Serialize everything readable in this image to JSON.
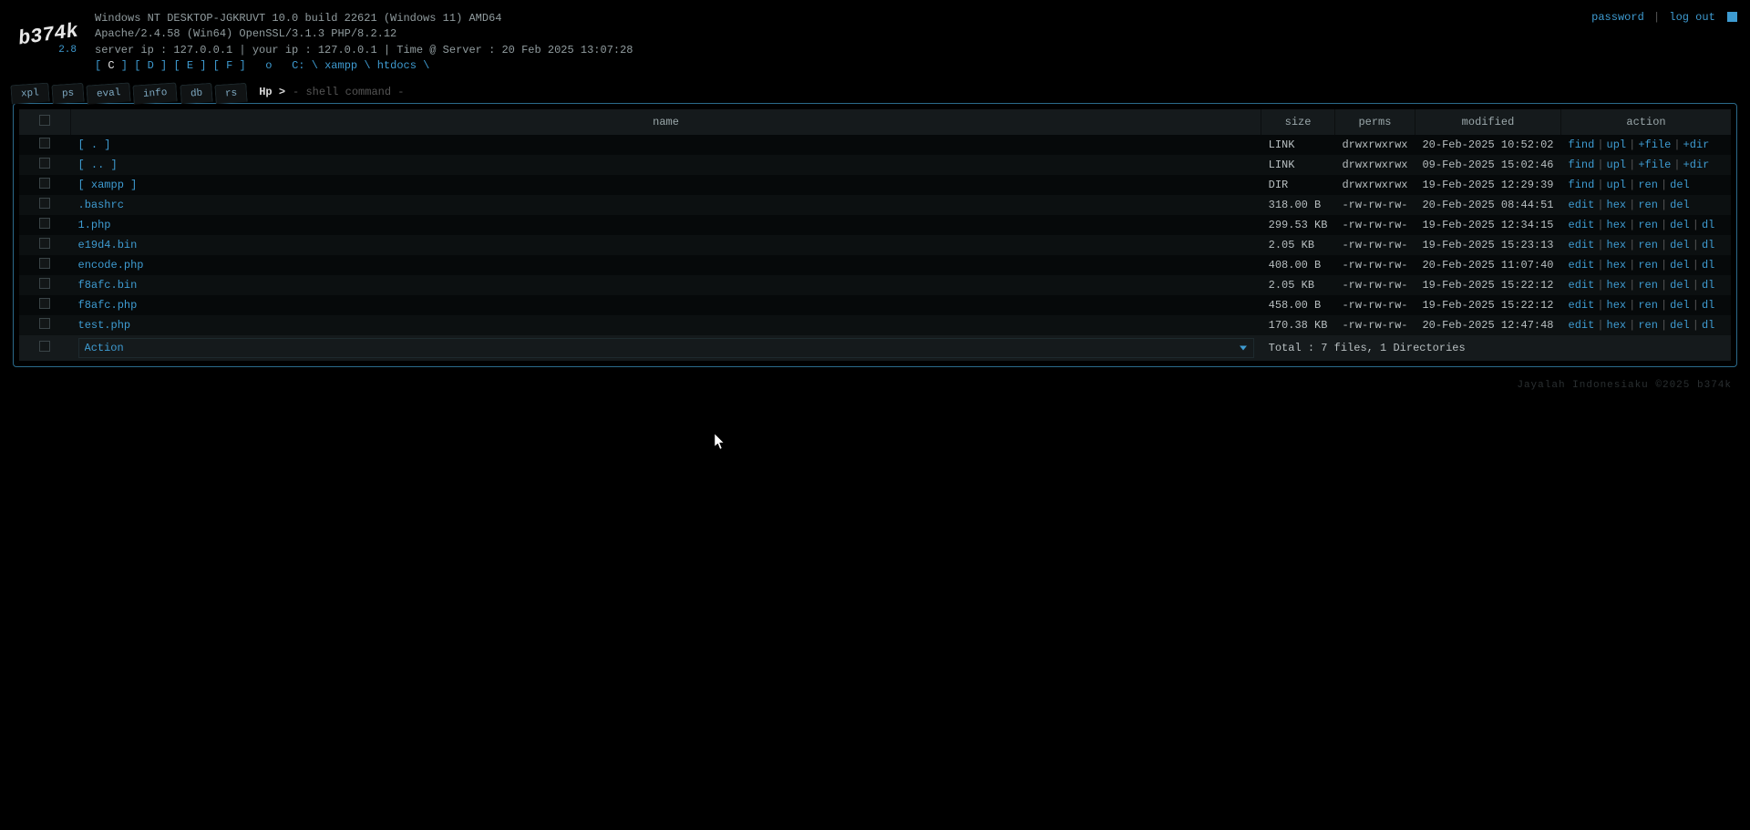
{
  "logo": {
    "main": "b374k",
    "sub": "2.8"
  },
  "topright": {
    "password": "password",
    "logout": "log out"
  },
  "sys": {
    "os": "Windows NT DESKTOP-JGKRUVT 10.0 build 22621 (Windows 11) AMD64",
    "server": "Apache/2.4.58 (Win64) OpenSSL/3.1.3 PHP/8.2.12",
    "ips": "server ip : 127.0.0.1 | your ip : 127.0.0.1 | Time @ Server : 20 Feb 2025 13:07:28"
  },
  "drives": {
    "list": [
      "C",
      "D",
      "E",
      "F"
    ],
    "current": "C",
    "extra": "o"
  },
  "path": [
    "C:",
    "xampp",
    "htdocs"
  ],
  "tabs": [
    "xpl",
    "ps",
    "eval",
    "info",
    "db",
    "rs"
  ],
  "shell": {
    "prompt": "Hp >",
    "placeholder": "- shell command -"
  },
  "columns": {
    "name": "name",
    "size": "size",
    "perms": "perms",
    "modified": "modified",
    "action": "action"
  },
  "rows": [
    {
      "type": "link",
      "name": "[ . ]",
      "size": "LINK",
      "perms": "drwxrwxrwx",
      "modified": "20-Feb-2025 10:52:02",
      "actions": [
        "find",
        "upl",
        "+file",
        "+dir"
      ]
    },
    {
      "type": "link",
      "name": "[ .. ]",
      "size": "LINK",
      "perms": "drwxrwxrwx",
      "modified": "09-Feb-2025 15:02:46",
      "actions": [
        "find",
        "upl",
        "+file",
        "+dir"
      ]
    },
    {
      "type": "dir",
      "name": "[ xampp ]",
      "size": "DIR",
      "perms": "drwxrwxrwx",
      "modified": "19-Feb-2025 12:29:39",
      "actions": [
        "find",
        "upl",
        "ren",
        "del"
      ]
    },
    {
      "type": "file",
      "name": ".bashrc",
      "size": "318.00 B",
      "perms": "-rw-rw-rw-",
      "modified": "20-Feb-2025 08:44:51",
      "actions": [
        "edit",
        "hex",
        "ren",
        "del"
      ]
    },
    {
      "type": "file",
      "name": "1.php",
      "size": "299.53 KB",
      "perms": "-rw-rw-rw-",
      "modified": "19-Feb-2025 12:34:15",
      "actions": [
        "edit",
        "hex",
        "ren",
        "del",
        "dl"
      ]
    },
    {
      "type": "file",
      "name": "e19d4.bin",
      "size": "2.05 KB",
      "perms": "-rw-rw-rw-",
      "modified": "19-Feb-2025 15:23:13",
      "actions": [
        "edit",
        "hex",
        "ren",
        "del",
        "dl"
      ]
    },
    {
      "type": "file",
      "name": "encode.php",
      "size": "408.00 B",
      "perms": "-rw-rw-rw-",
      "modified": "20-Feb-2025 11:07:40",
      "actions": [
        "edit",
        "hex",
        "ren",
        "del",
        "dl"
      ]
    },
    {
      "type": "file",
      "name": "f8afc.bin",
      "size": "2.05 KB",
      "perms": "-rw-rw-rw-",
      "modified": "19-Feb-2025 15:22:12",
      "actions": [
        "edit",
        "hex",
        "ren",
        "del",
        "dl"
      ]
    },
    {
      "type": "file",
      "name": "f8afc.php",
      "size": "458.00 B",
      "perms": "-rw-rw-rw-",
      "modified": "19-Feb-2025 15:22:12",
      "actions": [
        "edit",
        "hex",
        "ren",
        "del",
        "dl"
      ]
    },
    {
      "type": "file",
      "name": "test.php",
      "size": "170.38 KB",
      "perms": "-rw-rw-rw-",
      "modified": "20-Feb-2025 12:47:48",
      "actions": [
        "edit",
        "hex",
        "ren",
        "del",
        "dl"
      ]
    }
  ],
  "footer": {
    "action_label": "Action",
    "totals": "Total : 7 files, 1 Directories"
  },
  "credit": "Jayalah Indonesiaku ©2025 b374k"
}
